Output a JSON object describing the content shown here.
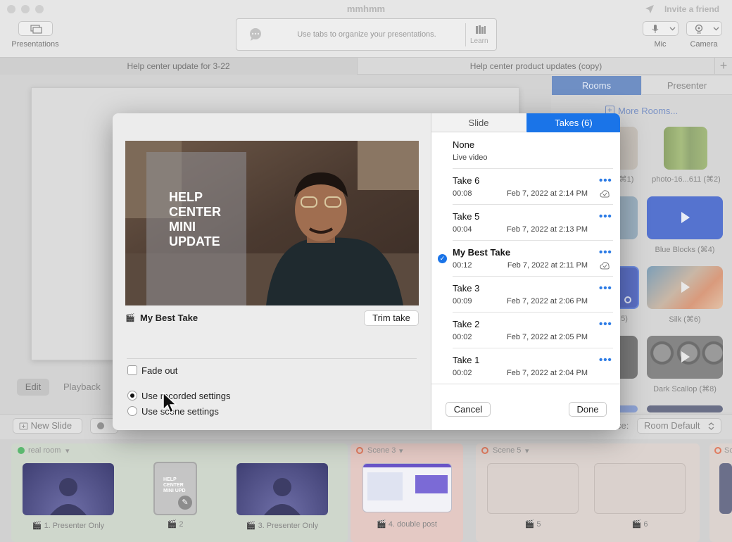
{
  "window": {
    "title": "mmhmm",
    "invite": "Invite a friend"
  },
  "toolbar": {
    "presentations_label": "Presentations",
    "tip_text": "Use tabs to organize your presentations.",
    "learn_label": "Learn",
    "mic_label": "Mic",
    "camera_label": "Camera"
  },
  "doc_tabs": [
    {
      "label": "Help center update for 3-22"
    },
    {
      "label": "Help center product updates (copy)"
    }
  ],
  "right_panel": {
    "tabs": {
      "rooms": "Rooms",
      "presenter": "Presenter"
    },
    "more_rooms": "More Rooms...",
    "rooms": [
      {
        "label": "⌘1)"
      },
      {
        "label": "photo-16...611 (⌘2)"
      },
      {
        "label": "Blue Blocks (⌘4)"
      },
      {
        "label": "5)"
      },
      {
        "label": "Silk (⌘6)"
      },
      {
        "label": "Dark Scallop (⌘8)"
      }
    ]
  },
  "edit_bar": {
    "edit": "Edit",
    "playback": "Playback"
  },
  "bottom_bar": {
    "new_slide": "New Slide",
    "room_label": "ce:",
    "room_value": "Room Default"
  },
  "scenes": [
    {
      "name": "real room",
      "slides": [
        "1. Presenter Only",
        "2",
        "3. Presenter Only"
      ]
    },
    {
      "name": "Scene 3",
      "slides": [
        "4. double post"
      ]
    },
    {
      "name": "Scene 5",
      "slides": [
        "5",
        "6"
      ]
    },
    {
      "name": "Sc"
    }
  ],
  "thumb_text": "HELP CENTER MINI UPD",
  "modal": {
    "preview_text": [
      "HELP",
      "CENTER",
      "MINI",
      "UPDATE"
    ],
    "take_title": "My Best Take",
    "trim_label": "Trim take",
    "fade_out_label": "Fade out",
    "radio_recorded": "Use recorded settings",
    "radio_scene": "Use scene settings",
    "tab_slide": "Slide",
    "tab_takes": "Takes (6)",
    "none_take": {
      "name": "None",
      "sub": "Live video"
    },
    "takes": [
      {
        "name": "Take 6",
        "duration": "00:08",
        "date": "Feb 7, 2022 at 2:14 PM"
      },
      {
        "name": "Take 5",
        "duration": "00:04",
        "date": "Feb 7, 2022 at 2:13 PM"
      },
      {
        "name": "My Best Take",
        "duration": "00:12",
        "date": "Feb 7, 2022 at 2:11 PM"
      },
      {
        "name": "Take 3",
        "duration": "00:09",
        "date": "Feb 7, 2022 at 2:06 PM"
      },
      {
        "name": "Take 2",
        "duration": "00:02",
        "date": "Feb 7, 2022 at 2:05 PM"
      },
      {
        "name": "Take 1",
        "duration": "00:02",
        "date": "Feb 7, 2022 at 2:04 PM"
      }
    ],
    "more_glyph": "•••",
    "cancel_label": "Cancel",
    "done_label": "Done"
  },
  "colors": {
    "accent": "#1a74e8",
    "rooms_tab": "#6f8fc4",
    "scene3_bg": "#e4c9c4"
  }
}
